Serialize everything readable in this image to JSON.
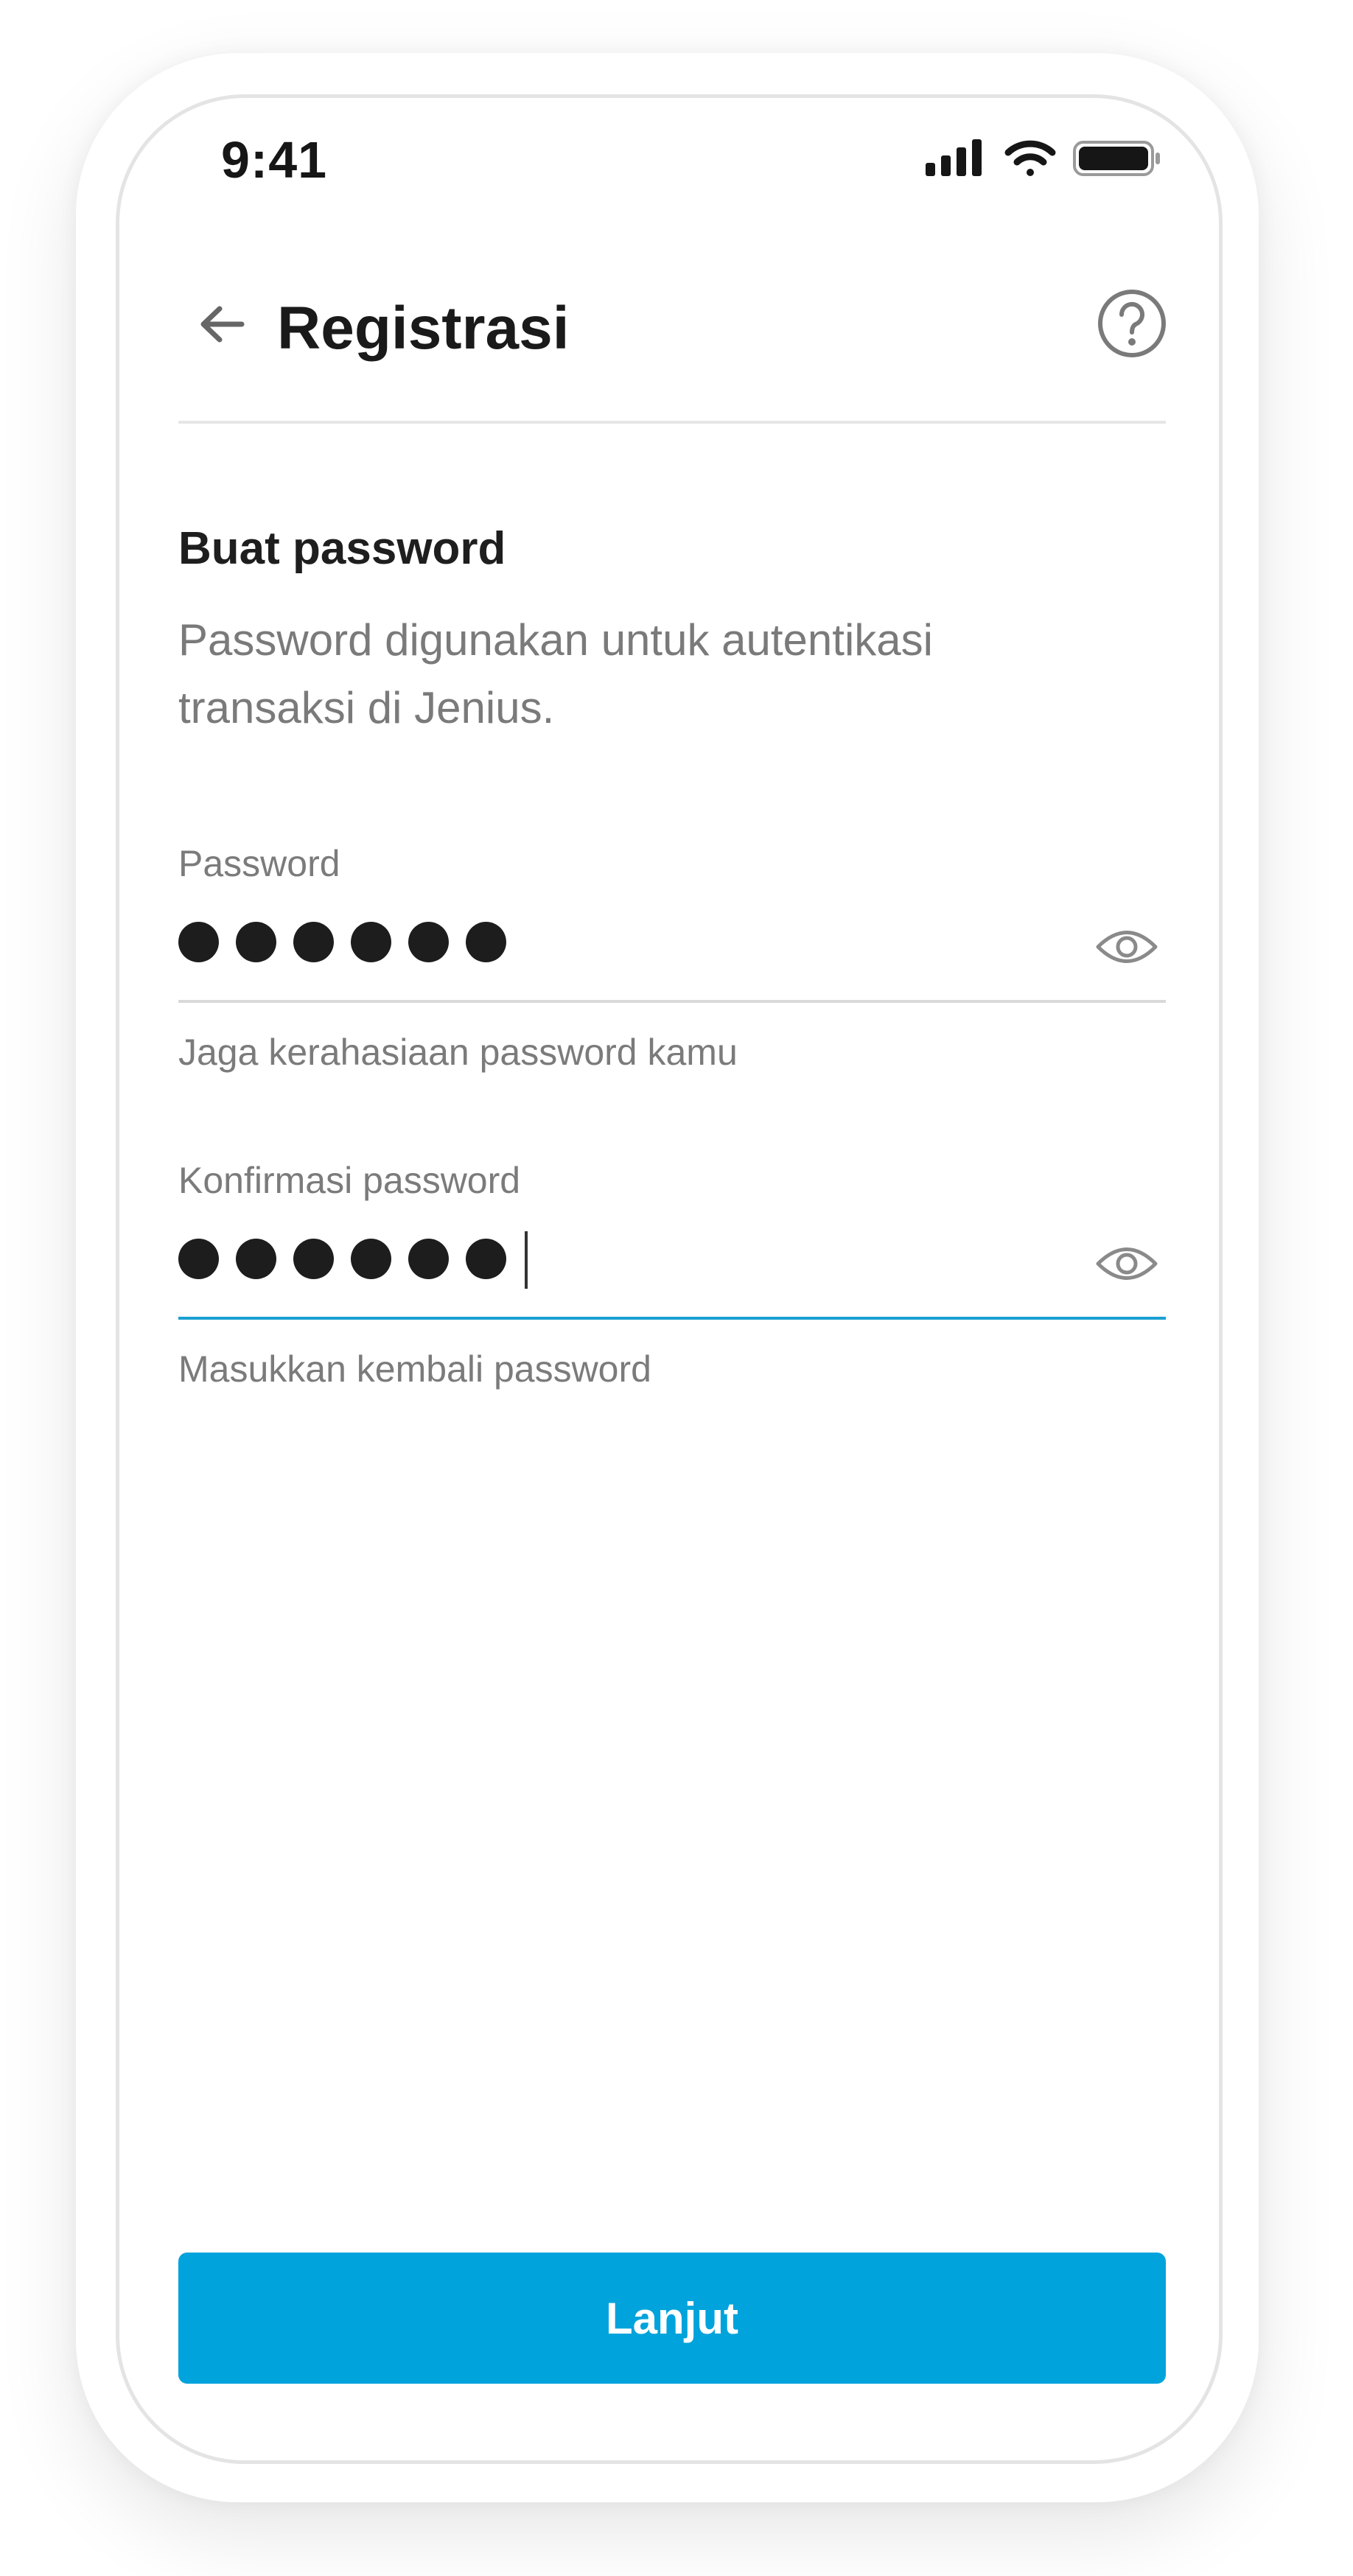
{
  "status_bar": {
    "time": "9:41",
    "icons": [
      "signal-icon",
      "wifi-icon",
      "battery-icon"
    ]
  },
  "header": {
    "title": "Registrasi",
    "back_icon": "arrow-left-icon",
    "help_icon": "help-circle-icon"
  },
  "content": {
    "title": "Buat password",
    "description": "Password digunakan untuk autentikasi transaksi di Jenius."
  },
  "fields": [
    {
      "label": "Password",
      "masked_length": 6,
      "hint": "Jaga kerahasiaan password kamu",
      "focused": false,
      "visibility_icon": "eye-icon"
    },
    {
      "label": "Konfirmasi password",
      "masked_length": 6,
      "hint": "Masukkan kembali password",
      "focused": true,
      "visibility_icon": "eye-icon"
    }
  ],
  "actions": {
    "next_label": "Lanjut"
  },
  "colors": {
    "accent": "#00a3dc",
    "focus_line": "#1aa0d2",
    "text_primary": "#1a1a1a",
    "text_secondary": "#7a7a7a",
    "divider": "#e6e6e6"
  }
}
